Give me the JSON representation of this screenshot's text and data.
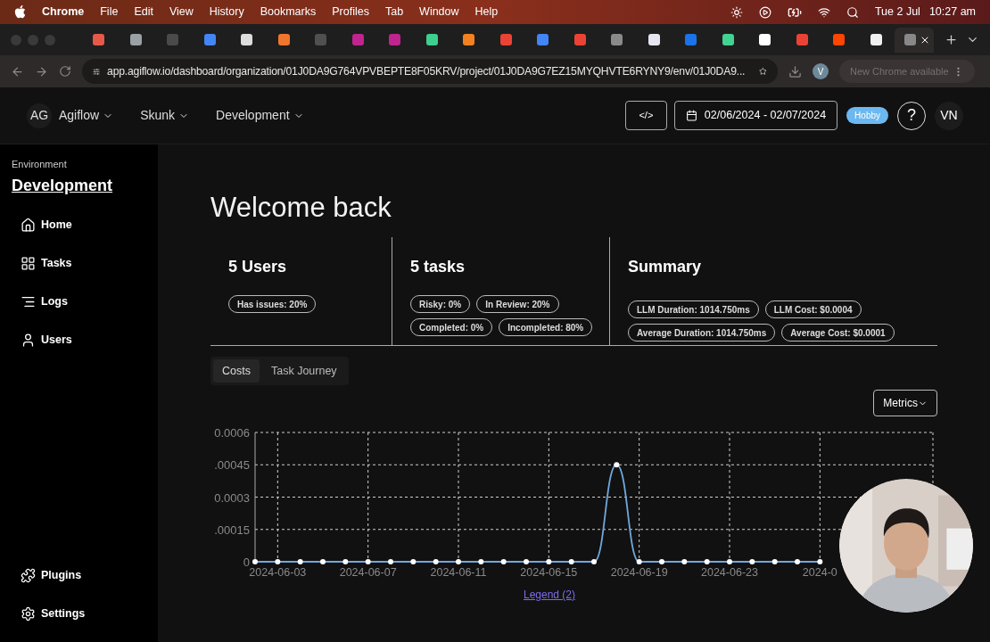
{
  "menu_bar": {
    "app": "Chrome",
    "menus": [
      "File",
      "Edit",
      "View",
      "History",
      "Bookmarks",
      "Profiles",
      "Tab",
      "Window",
      "Help"
    ],
    "date": "Tue 2 Jul",
    "time": "10:27 am"
  },
  "browser": {
    "tabs": [
      {
        "color": "#e8584a",
        "selected": false
      },
      {
        "color": "#9aa0a6",
        "selected": false
      },
      {
        "color": "#4a4a4a",
        "selected": false
      },
      {
        "color": "#4285f4",
        "selected": false
      },
      {
        "color": "#dddddd",
        "selected": false
      },
      {
        "color": "#f0762d",
        "selected": false
      },
      {
        "color": "#505050",
        "selected": false
      },
      {
        "color": "#c0258f",
        "selected": false
      },
      {
        "color": "#c0258f",
        "selected": false
      },
      {
        "color": "#3ecf8e",
        "selected": false
      },
      {
        "color": "#f48120",
        "selected": false
      },
      {
        "color": "#ea4335",
        "selected": false
      },
      {
        "color": "#4285f4",
        "selected": false
      },
      {
        "color": "#ea4335",
        "selected": false
      },
      {
        "color": "#8a8a8a",
        "selected": false
      },
      {
        "color": "#e6e6f0",
        "selected": false
      },
      {
        "color": "#1a73e8",
        "selected": false
      },
      {
        "color": "#42d392",
        "selected": false
      },
      {
        "color": "#ffffff",
        "selected": false
      },
      {
        "color": "#ea4335",
        "selected": false
      },
      {
        "color": "#ff4500",
        "selected": false
      },
      {
        "color": "#f0f0f0",
        "selected": false
      },
      {
        "color": "#888888",
        "selected": true
      }
    ],
    "url": "app.agiflow.io/dashboard/organization/01J0DA9G764VPVBEPTE8F05KRV/project/01J0DA9G7EZ15MYQHVTE6RYNY9/env/01J0DA9...",
    "profile": "V",
    "update": "New Chrome available"
  },
  "header": {
    "initials": "AG",
    "crumbs": [
      "Agiflow",
      "Skunk",
      "Development"
    ],
    "code_button": "</>",
    "date_range": "02/06/2024 - 02/07/2024",
    "plan": "Hobby",
    "help": "?",
    "user": "VN"
  },
  "sidebar": {
    "label": "Environment",
    "title": "Development",
    "items": [
      {
        "kind": "home",
        "label": "Home"
      },
      {
        "kind": "tasks",
        "label": "Tasks"
      },
      {
        "kind": "logs",
        "label": "Logs"
      },
      {
        "kind": "users",
        "label": "Users"
      }
    ],
    "bottom_items": [
      {
        "kind": "plugins",
        "label": "Plugins"
      },
      {
        "kind": "settings",
        "label": "Settings"
      }
    ]
  },
  "main": {
    "title": "Welcome back",
    "stats": [
      {
        "title": "5 Users",
        "badges": [
          "Has issues: 20%"
        ]
      },
      {
        "title": "5 tasks",
        "badges": [
          "Risky: 0%",
          "In Review: 20%",
          "Completed: 0%",
          "Incompleted: 80%"
        ]
      },
      {
        "title": "Summary",
        "badges": [
          "LLM Duration: 1014.750ms",
          "LLM Cost: $0.0004",
          "Average Duration: 1014.750ms",
          "Average Cost: $0.0001"
        ]
      }
    ],
    "view_tabs": [
      {
        "label": "Costs",
        "selected": true
      },
      {
        "label": "Task Journey",
        "selected": false
      }
    ],
    "metrics_button": "Metrics",
    "chart_data": {
      "type": "line",
      "grid": true,
      "xlim": [
        "2024-06-02",
        "2024-07-02"
      ],
      "x": [
        "2024-06-02",
        "2024-06-03",
        "2024-06-04",
        "2024-06-05",
        "2024-06-06",
        "2024-06-07",
        "2024-06-08",
        "2024-06-09",
        "2024-06-10",
        "2024-06-11",
        "2024-06-12",
        "2024-06-13",
        "2024-06-14",
        "2024-06-15",
        "2024-06-16",
        "2024-06-17",
        "2024-06-18",
        "2024-06-19",
        "2024-06-20",
        "2024-06-21",
        "2024-06-22",
        "2024-06-23",
        "2024-06-24",
        "2024-06-25",
        "2024-06-26",
        "2024-06-27"
      ],
      "series": [
        {
          "color": "#6fa8dc",
          "marker": true,
          "values": [
            0,
            0,
            0,
            0,
            0,
            0,
            0,
            0,
            0,
            0,
            0,
            0,
            0,
            0,
            0,
            0,
            0.00045,
            0,
            0,
            0,
            0,
            0,
            0,
            0,
            0,
            0
          ]
        }
      ],
      "ylim": [
        0,
        0.0006
      ],
      "yticks": [
        {
          "value": 0,
          "label": "0"
        },
        {
          "value": 0.00015,
          "label": ".00015"
        },
        {
          "value": 0.0003,
          "label": "0.0003"
        },
        {
          "value": 0.00045,
          "label": ".00045"
        },
        {
          "value": 0.0006,
          "label": "0.0006"
        }
      ],
      "xticks": [
        {
          "value": "2024-06-03",
          "label": "2024-06-03"
        },
        {
          "value": "2024-06-07",
          "label": "2024-06-07"
        },
        {
          "value": "2024-06-11",
          "label": "2024-06-11"
        },
        {
          "value": "2024-06-15",
          "label": "2024-06-15"
        },
        {
          "value": "2024-06-19",
          "label": "2024-06-19"
        },
        {
          "value": "2024-06-23",
          "label": "2024-06-23"
        },
        {
          "value": "2024-06-27",
          "label": "2024-0"
        }
      ]
    },
    "legend_link": "Legend (2)"
  }
}
